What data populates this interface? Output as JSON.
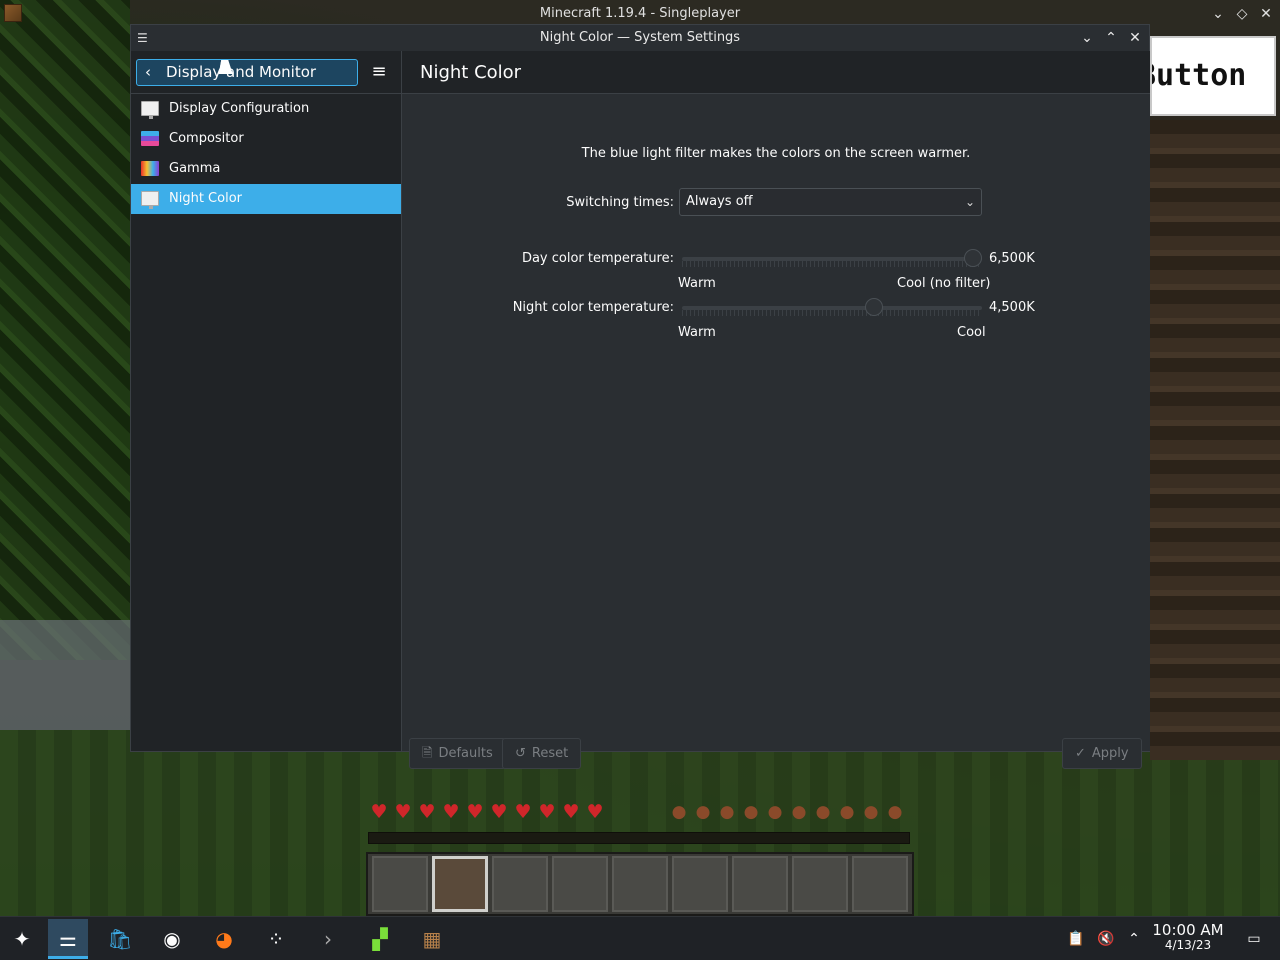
{
  "mc": {
    "window_title": "Minecraft 1.19.4 - Singleplayer",
    "button_text": "Button",
    "hearts": [
      "♥",
      "♥",
      "♥",
      "♥",
      "♥",
      "♥",
      "♥",
      "♥",
      "♥",
      "♥"
    ],
    "food": [
      "●",
      "●",
      "●",
      "●",
      "●",
      "●",
      "●",
      "●",
      "●",
      "●"
    ],
    "hotbar_slots": 9,
    "hotbar_selected": 1
  },
  "window": {
    "title": "Night Color — System Settings"
  },
  "sidebar": {
    "back_label": "Display and Monitor",
    "items": [
      {
        "label": "Display Configuration",
        "icon": "display-icon",
        "active": false
      },
      {
        "label": "Compositor",
        "icon": "compositor-icon",
        "active": false
      },
      {
        "label": "Gamma",
        "icon": "gamma-icon",
        "active": false
      },
      {
        "label": "Night Color",
        "icon": "display-icon",
        "active": true
      }
    ]
  },
  "main": {
    "title": "Night Color",
    "description": "The blue light filter makes the colors on the screen warmer.",
    "switching_label": "Switching times:",
    "switching_value": "Always off",
    "day": {
      "label": "Day color temperature:",
      "value": "6,500K",
      "warm": "Warm",
      "cool": "Cool (no filter)",
      "fraction": 1.0
    },
    "night": {
      "label": "Night color temperature:",
      "value": "4,500K",
      "warm": "Warm",
      "cool": "Cool",
      "fraction": 0.65
    },
    "buttons": {
      "defaults": "Defaults",
      "reset": "Reset",
      "apply": "Apply"
    }
  },
  "taskbar": {
    "time": "10:00 AM",
    "date": "4/13/23"
  },
  "colors": {
    "accent": "#3daee9",
    "window_bg": "#2a2e32",
    "sidebar_bg": "#202326"
  }
}
